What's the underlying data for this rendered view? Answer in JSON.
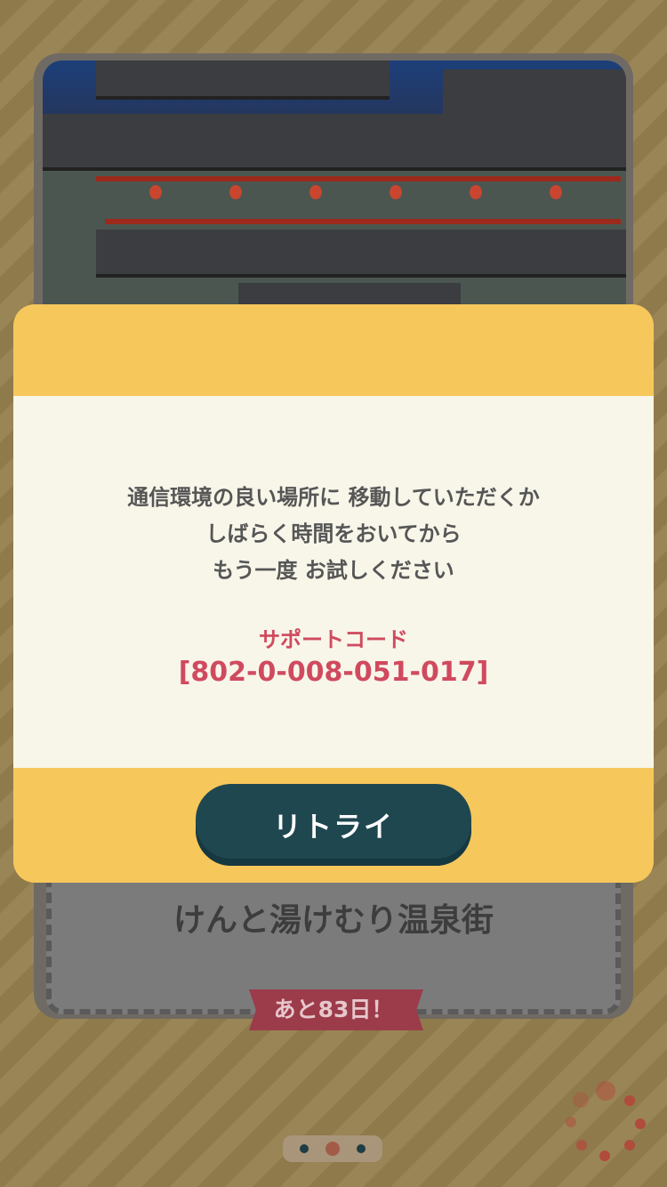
{
  "background": {
    "event_title": "けんと湯けむり温泉街",
    "days_left": "あと83日！",
    "pagination": {
      "count": 3,
      "active_index": 1
    }
  },
  "dialog": {
    "message_lines": [
      "通信環境の良い場所に 移動していただくか",
      "しばらく時間をおいてから",
      "もう一度 お試しください"
    ],
    "support_label": "サポートコード",
    "support_code": "[802-0-008-051-017]",
    "retry_label": "リトライ"
  },
  "colors": {
    "dialog_header": "#f6c75b",
    "dialog_body": "#f8f6e9",
    "retry_button": "#1f4750",
    "support_text": "#d04a5f",
    "ribbon": "#9c3b4a"
  }
}
